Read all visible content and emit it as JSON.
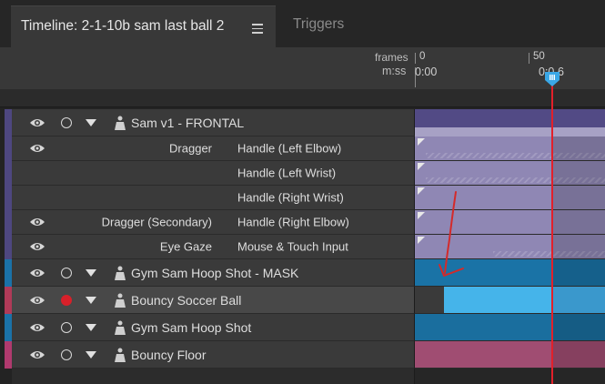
{
  "tabs": {
    "active": "Timeline: 2-1-10b sam last ball 2",
    "inactive": "Triggers"
  },
  "ruler": {
    "frames_label": "frames",
    "time_label": "m:ss",
    "frame_0": "0",
    "frame_50": "50",
    "time_0": "0:00",
    "time_playhead": "0:0",
    "time_suffix": "6"
  },
  "rows": [
    {
      "name": "Sam v1 - FRONTAL",
      "type": "puppet",
      "stripe": "#4e4780",
      "bar": "#5a5090"
    },
    {
      "name": "Handle (Left Elbow)",
      "behavior": "Dragger",
      "type": "handle",
      "bar": "#8e86b4"
    },
    {
      "name": "Handle (Left Wrist)",
      "behavior": "",
      "type": "handle",
      "bar": "#8e86b4"
    },
    {
      "name": "Handle (Right Wrist)",
      "behavior": "",
      "type": "handle",
      "bar": "#8e86b4"
    },
    {
      "name": "Handle (Right Elbow)",
      "behavior": "Dragger (Secondary)",
      "type": "handle",
      "bar": "#8e86b4"
    },
    {
      "name": "Mouse & Touch Input",
      "behavior": "Eye Gaze",
      "type": "handle",
      "bar": "#8e86b4"
    },
    {
      "name": "Gym Sam Hoop Shot - MASK",
      "type": "puppet",
      "stripe": "#1b72a8",
      "bar": "#1a73a6"
    },
    {
      "name": "Bouncy Soccer Ball",
      "type": "puppet",
      "stripe": "#b03a58",
      "bar": "#45b4ea",
      "record": true
    },
    {
      "name": "Gym Sam Hoop Shot",
      "type": "puppet",
      "stripe": "#1b72a8",
      "bar": "#1a6e9e"
    },
    {
      "name": "Bouncy Floor",
      "type": "puppet",
      "stripe": "#b03a6e",
      "bar": "#a04d72"
    }
  ],
  "colors": {
    "playhead": "#e2202a",
    "playhead_handle": "#3aa7e6",
    "annotation": "#d42a2a"
  }
}
